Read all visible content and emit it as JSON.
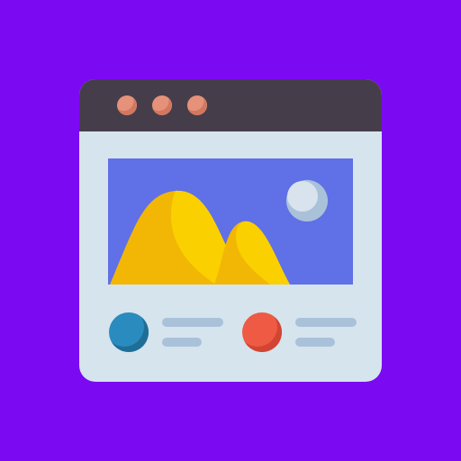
{
  "colors": {
    "background": "#7B0AF2",
    "window_titlebar": "#463D4B",
    "window_body": "#D6E4EE",
    "titlebar_dot": "#E6927A",
    "titlebar_dot_shade": "#D4775F",
    "image_sky": "#6070E6",
    "hill_back": "#FAD000",
    "hill_back_shade": "#F2B705",
    "hill_front": "#FAD000",
    "hill_front_shade": "#F2B705",
    "moon": "#D8E3EE",
    "moon_shade": "#A9C2DA",
    "avatar_left": "#2A8BBE",
    "avatar_left_shade": "#1F6E98",
    "avatar_right": "#EE5A44",
    "avatar_right_shade": "#D24533",
    "text_line": "#A9C2DA"
  },
  "icons": {
    "window": "browser-window-icon",
    "image": "image-placeholder-icon",
    "mountains": "mountains-icon",
    "moon": "moon-icon",
    "avatar_left": "avatar-icon",
    "avatar_right": "avatar-icon"
  }
}
